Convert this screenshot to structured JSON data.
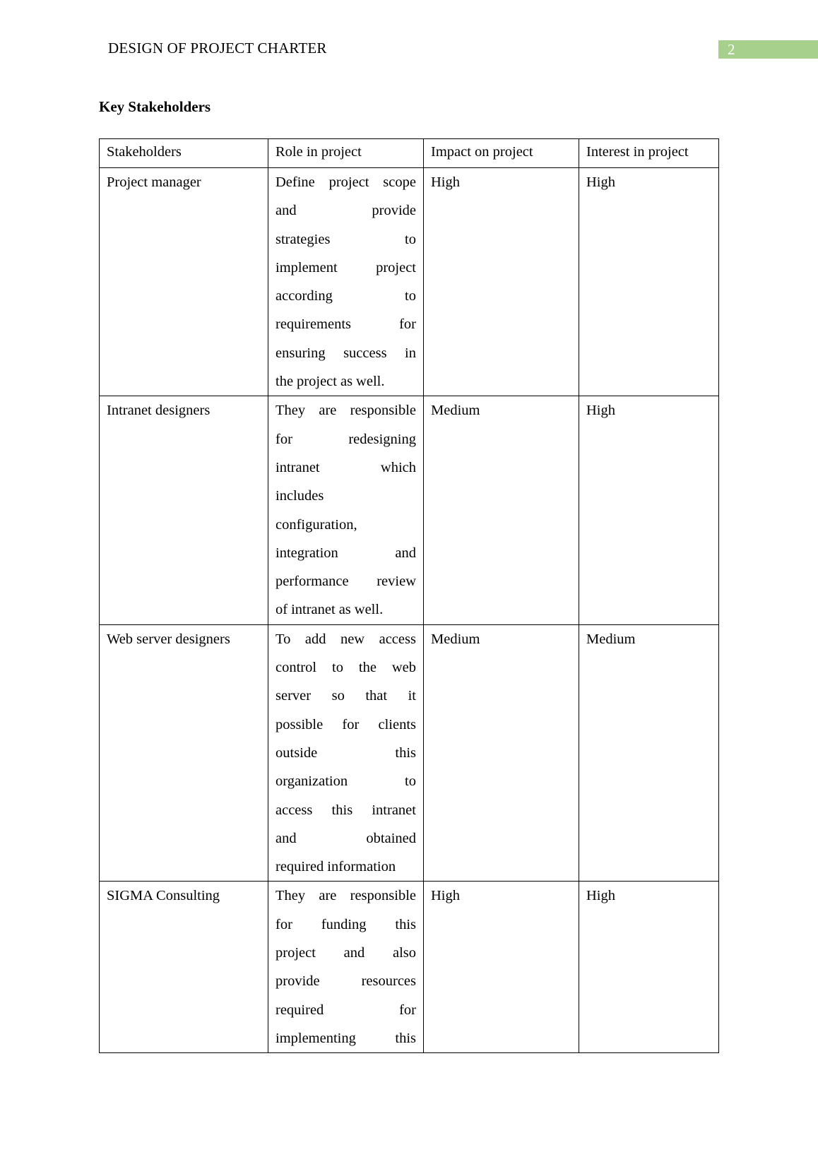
{
  "header": {
    "title": "DESIGN OF PROJECT CHARTER",
    "page_number": "2",
    "page_number_bg": "#a8d08d"
  },
  "section_title": "Key Stakeholders",
  "table": {
    "columns": [
      "Stakeholders",
      "Role in project",
      "Impact on project",
      "Interest in project"
    ],
    "rows": [
      {
        "stakeholder": "Project manager",
        "role_lines": [
          "Define project scope",
          "and provide",
          "strategies to",
          "implement project",
          "according to",
          "requirements for",
          "ensuring success in",
          "the project as well."
        ],
        "impact": "High",
        "interest": "High"
      },
      {
        "stakeholder": "Intranet designers",
        "role_lines": [
          "They are responsible",
          "for redesigning",
          "intranet which",
          "includes",
          "configuration,",
          "integration and",
          "performance review",
          "of intranet as well."
        ],
        "impact": "Medium",
        "interest": "High"
      },
      {
        "stakeholder": "Web server designers",
        "role_lines": [
          "To add new access",
          "control to the web",
          "server so that it",
          "possible for clients",
          "outside this",
          "organization to",
          "access this intranet",
          "and obtained",
          "required information"
        ],
        "impact": "Medium",
        "interest": "Medium"
      },
      {
        "stakeholder": "SIGMA Consulting",
        "role_lines": [
          "They are responsible",
          "for funding this",
          "project and also",
          "provide resources",
          "required for",
          "implementing this"
        ],
        "impact": "High",
        "interest": "High"
      }
    ]
  }
}
